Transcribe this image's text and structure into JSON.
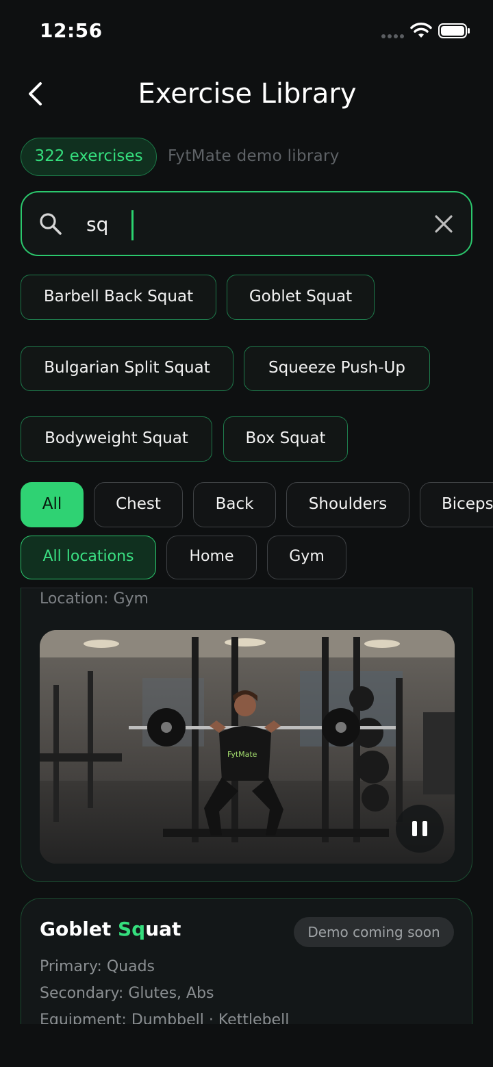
{
  "status": {
    "time": "12:56"
  },
  "header": {
    "title": "Exercise Library"
  },
  "meta": {
    "count": "322 exercises",
    "library": "FytMate demo library"
  },
  "search": {
    "value": "sq"
  },
  "suggestions": [
    "Barbell Back Squat",
    "Goblet Squat",
    "Bulgarian Split Squat",
    "Squeeze Push-Up",
    "Bodyweight Squat",
    "Box Squat"
  ],
  "muscle_filters": {
    "selected": "All",
    "items": [
      "All",
      "Chest",
      "Back",
      "Shoulders",
      "Biceps"
    ]
  },
  "location_filters": {
    "selected": "All locations",
    "items": [
      "All locations",
      "Home",
      "Gym"
    ]
  },
  "exercise_card_1": {
    "location": "Location: Gym",
    "shirt_text": "FytMate",
    "playback_state": "playing"
  },
  "exercise_card_2": {
    "title_prefix": "Goblet ",
    "title_match": "Sq",
    "title_suffix": "uat",
    "badge": "Demo coming soon",
    "primary_label": "Primary:",
    "primary_value": "Quads",
    "secondary_label": "Secondary:",
    "secondary_value": "Glutes, Abs",
    "equipment_label": "Equipment:",
    "equipment_value": "Dumbbell · Kettlebell"
  },
  "colors": {
    "accent": "#2fd273",
    "background": "#0e1011",
    "card": "#131718"
  }
}
